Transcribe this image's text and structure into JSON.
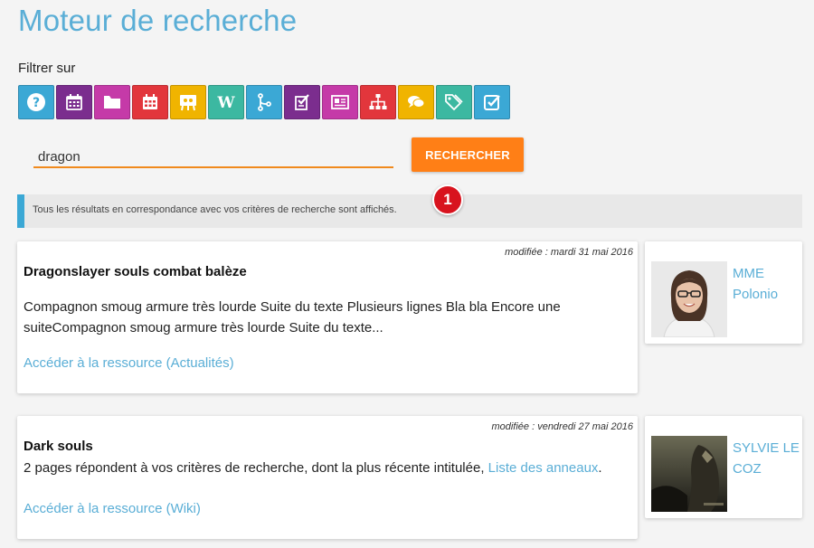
{
  "page": {
    "title": "Moteur de recherche"
  },
  "filters": {
    "label": "Filtrer sur",
    "items": [
      {
        "icon": "help-icon",
        "color": "#3ba8d5"
      },
      {
        "icon": "calendar-icon",
        "color": "#7b2d8e"
      },
      {
        "icon": "folder-icon",
        "color": "#c53aa8"
      },
      {
        "icon": "agenda-icon",
        "color": "#e2363c"
      },
      {
        "icon": "presentation-icon",
        "color": "#f0b400"
      },
      {
        "icon": "wiki-icon",
        "color": "#3cb8a1"
      },
      {
        "icon": "workflow-icon",
        "color": "#3ba8d5"
      },
      {
        "icon": "survey-icon",
        "color": "#7b2d8e"
      },
      {
        "icon": "news-icon",
        "color": "#c53aa8"
      },
      {
        "icon": "sitemap-icon",
        "color": "#e2363c"
      },
      {
        "icon": "chat-icon",
        "color": "#f0b400"
      },
      {
        "icon": "tags-icon",
        "color": "#3cb8a1"
      },
      {
        "icon": "checkbox-icon",
        "color": "#3ba8d5"
      }
    ]
  },
  "search": {
    "value": "dragon",
    "button_label": "RECHERCHER"
  },
  "info": {
    "message": "Tous les résultats en correspondance avec vos critères de recherche sont affichés.",
    "badge": "1"
  },
  "results": [
    {
      "date": "modifiée : mardi 31 mai 2016",
      "title": "Dragonslayer souls combat balèze",
      "text": "Compagnon smoug armure très lourde Suite du texte Plusieurs lignes Bla bla Encore une suiteCompagnon smoug armure très lourde Suite du texte...",
      "link": "Accéder à la ressource (Actualités)",
      "author": "MME Polonio"
    },
    {
      "date": "modifiée : vendredi 27 mai 2016",
      "title": "Dark souls",
      "text_prefix": "2 pages répondent à vos critères de recherche, dont la plus récente intitulée, ",
      "text_link": "Liste des anneaux",
      "text_suffix": ".",
      "link": "Accéder à la ressource (Wiki)",
      "author": "SYLVIE LE COZ"
    }
  ]
}
